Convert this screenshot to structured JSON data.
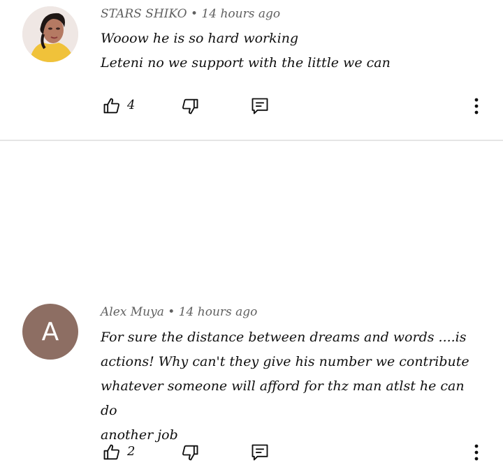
{
  "comments": [
    {
      "author": "STARS SHIKO",
      "separator": "•",
      "time": "14 hours ago",
      "lines": [
        "Wooow he is so hard working",
        "Leteni no we support with the little we can"
      ],
      "likes": "4",
      "avatar": {
        "type": "photo"
      }
    },
    {
      "author": "Alex Muya",
      "separator": "•",
      "time": "14 hours ago",
      "lines": [
        "For sure the distance between dreams and  words ....is",
        "actions! Why can't they give his number we contribute",
        "whatever someone will afford for thz man atlst he can do",
        "another job"
      ],
      "likes": "2",
      "avatar": {
        "type": "letter",
        "letter": "A",
        "color": "#8d6e63"
      }
    }
  ],
  "icons": {
    "like": "thumbs-up-icon",
    "dislike": "thumbs-down-icon",
    "reply": "reply-comment-icon",
    "more": "more-vertical-icon"
  },
  "colors": {
    "meta_text": "#606060",
    "body_text": "#0f0f0f",
    "divider": "#e5e5e5"
  }
}
